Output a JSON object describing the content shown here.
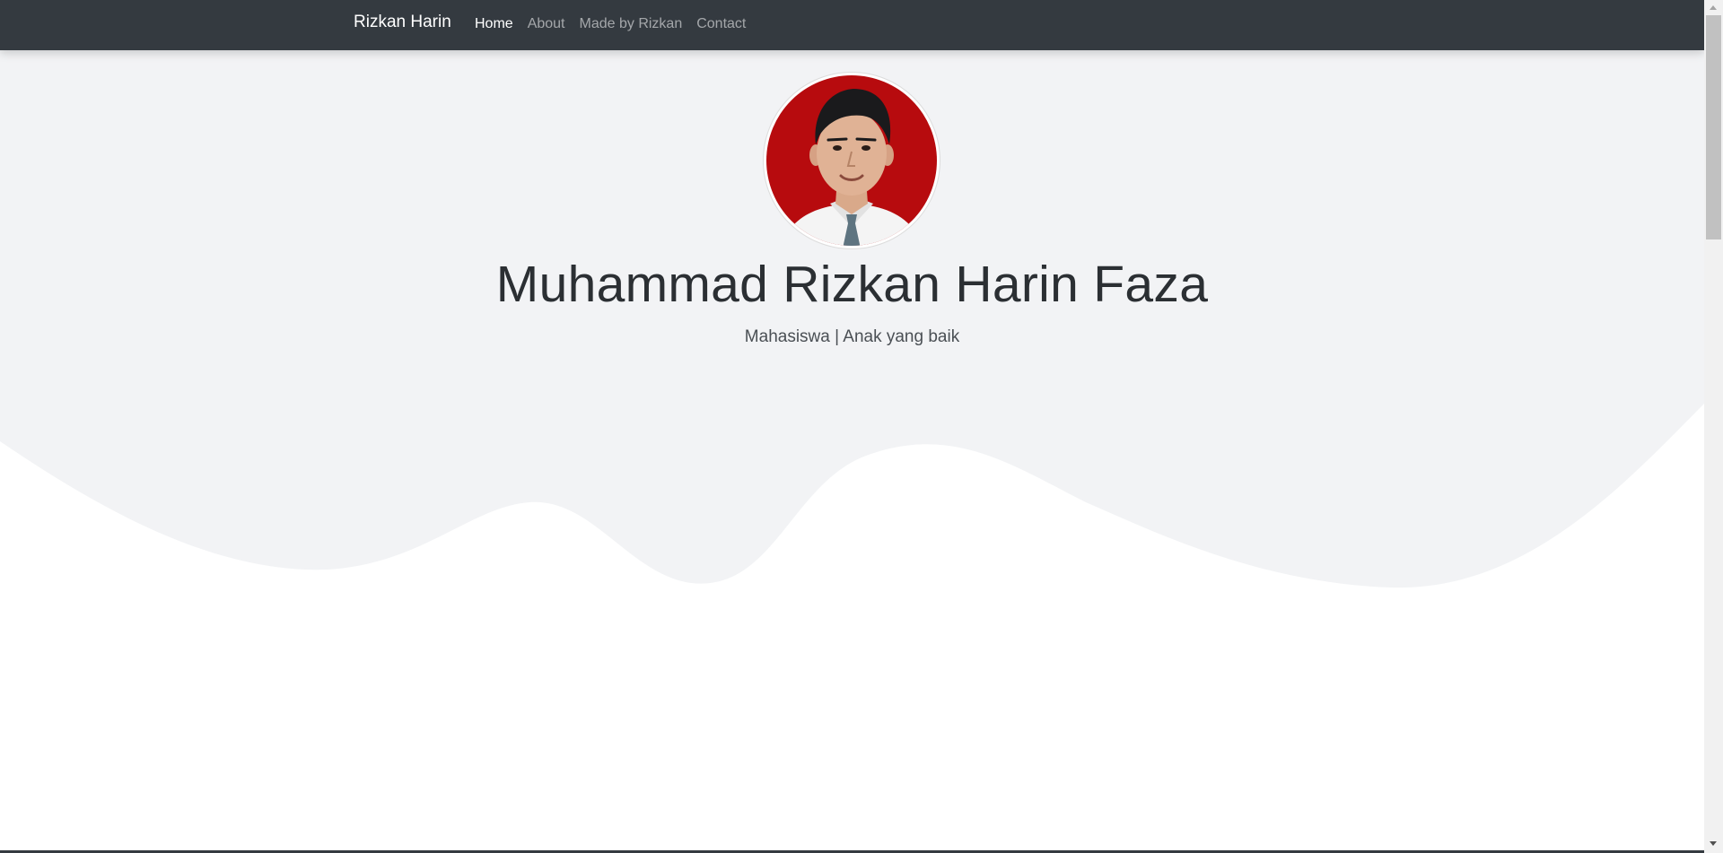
{
  "navbar": {
    "brand": "Rizkan Harin",
    "links": [
      {
        "label": "Home",
        "active": true
      },
      {
        "label": "About",
        "active": false
      },
      {
        "label": "Made by Rizkan",
        "active": false
      },
      {
        "label": "Contact",
        "active": false
      }
    ]
  },
  "hero": {
    "name": "Muhammad Rizkan Harin Faza",
    "tagline": "Mahasiswa | Anak yang baik",
    "avatar_icon": "profile-photo",
    "avatar_background": "#b70b0e"
  },
  "colors": {
    "navbar": "#343a40",
    "hero_background": "#f2f3f5",
    "page_background": "#ffffff"
  }
}
